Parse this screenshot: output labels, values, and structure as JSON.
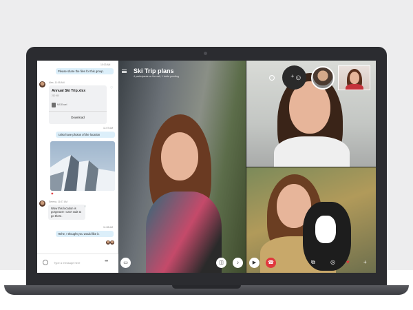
{
  "chat": {
    "time_1": "10:03 AM",
    "msg_1": "Please share the files for this group.",
    "sender_1": "Alex, 11:05 AM",
    "file_card": {
      "title": "Annual Ski Trip.xlsx",
      "size": "210 KB",
      "file_name": "MS Excel",
      "download_label": "Download"
    },
    "time_2": "11:07 AM",
    "msg_2": "I also have photos of the location",
    "sender_2": "Serena, 11:07 AM",
    "msg_3": "Wow this location is gorgeous! I can't wait to go there.",
    "time_3": "11:08 AM",
    "msg_4": "Hehe, I thought you would like it.",
    "composer_placeholder": "Type a message here"
  },
  "call": {
    "title": "Ski Trip plans",
    "subtitle": "4 participants on the call, 1 invite pending"
  },
  "colors": {
    "accent": "#00aff0",
    "end_call": "#e0373d",
    "bubble_out": "#dceffa",
    "bubble_in": "#f0f1f3"
  },
  "icons": {
    "menu": "hamburger-icon",
    "settings": "gear-icon",
    "add_participant": "add-person-icon",
    "emoji": "emoji-icon",
    "more": "more-icon",
    "heart": "heart-icon",
    "end_call": "hangup-icon",
    "video": "camera-icon",
    "mic": "microphone-icon"
  }
}
